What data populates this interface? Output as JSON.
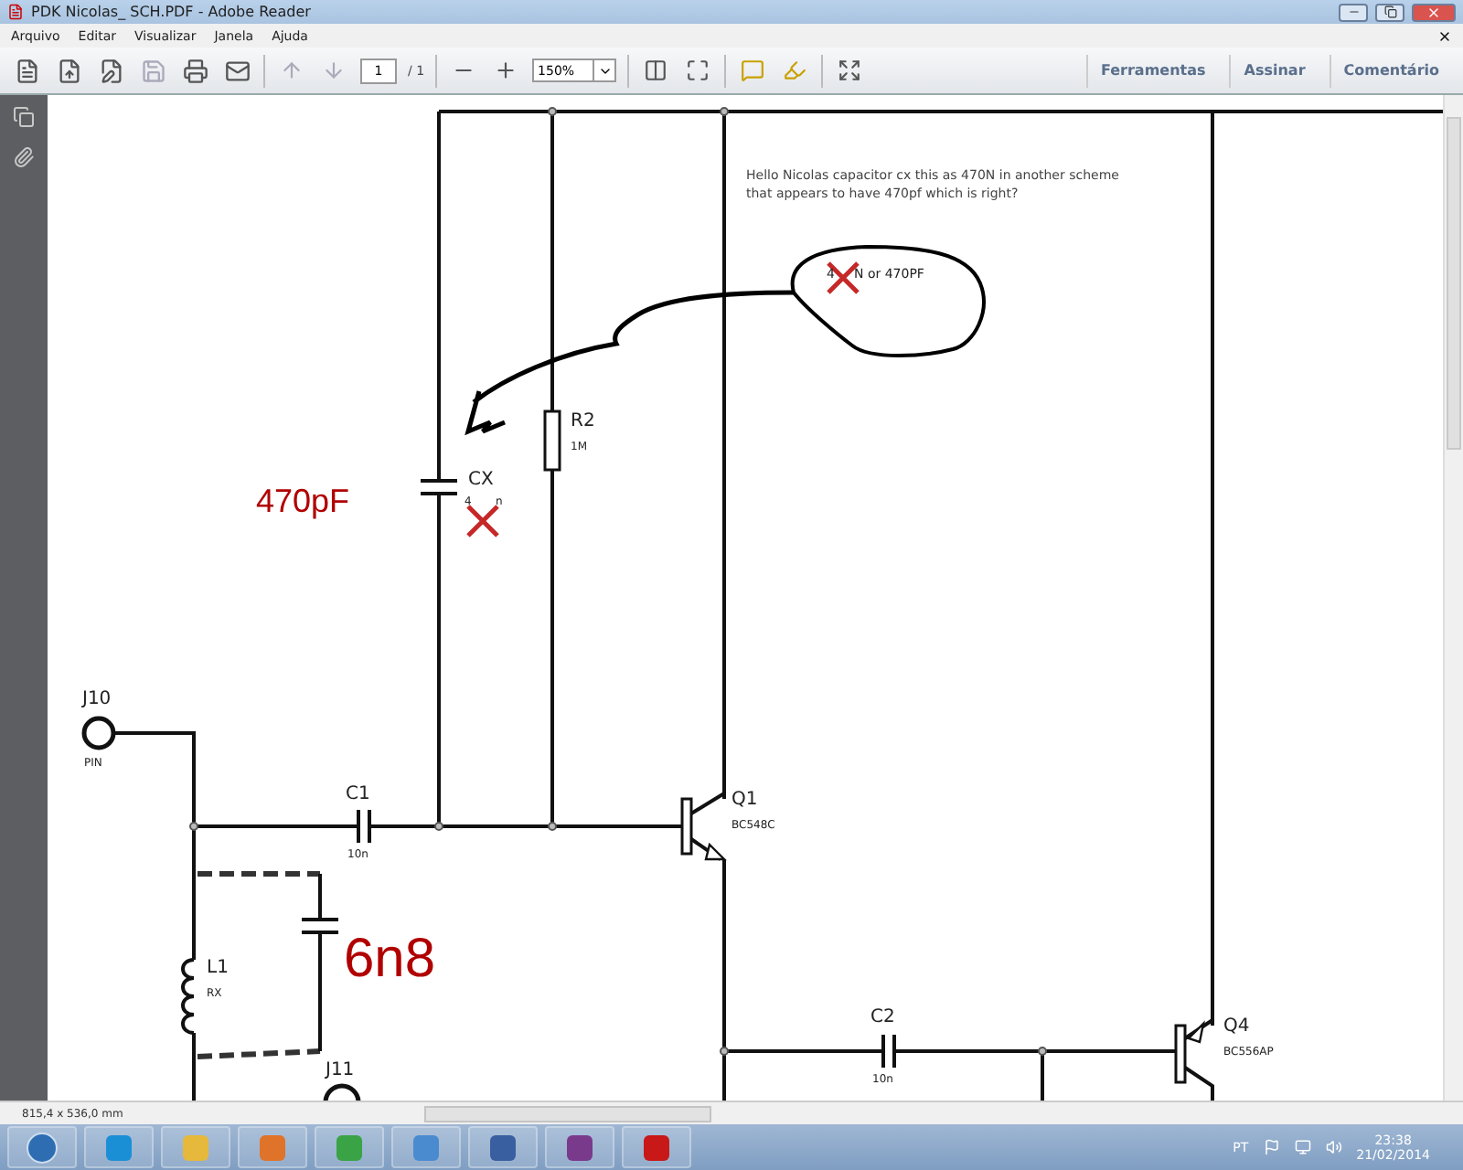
{
  "window": {
    "title": "PDK Nicolas_ SCH.PDF - Adobe Reader"
  },
  "menu": [
    "Arquivo",
    "Editar",
    "Visualizar",
    "Janela",
    "Ajuda"
  ],
  "toolbar": {
    "page": "1",
    "page_total": "/ 1",
    "zoom": "150%",
    "panels": [
      "Ferramentas",
      "Assinar",
      "Comentário"
    ]
  },
  "schematic": {
    "labels": [
      {
        "text": "Hello Nicolas capacitor cx this as 470N in another scheme that appears to have 470pf which is right?",
        "kind": "note"
      },
      {
        "text": "4",
        "kind": "note"
      },
      {
        "text": "N or 470PF",
        "kind": "note"
      },
      {
        "text": "R2",
        "kind": "ref"
      },
      {
        "text": "1M",
        "kind": "value"
      },
      {
        "text": "CX",
        "kind": "ref"
      },
      {
        "text": "470pF",
        "kind": "handwritten"
      },
      {
        "text": "4",
        "kind": "value"
      },
      {
        "text": "n",
        "kind": "value"
      },
      {
        "text": "J10",
        "kind": "ref"
      },
      {
        "text": "PIN",
        "kind": "value"
      },
      {
        "text": "C1",
        "kind": "ref"
      },
      {
        "text": "Q1",
        "kind": "ref"
      },
      {
        "text": "BC548C",
        "kind": "value"
      },
      {
        "text": "10n",
        "kind": "value"
      },
      {
        "text": "L1",
        "kind": "ref"
      },
      {
        "text": "RX",
        "kind": "value"
      },
      {
        "text": "6n8",
        "kind": "handwritten"
      },
      {
        "text": "C2",
        "kind": "ref"
      },
      {
        "text": "Q4",
        "kind": "ref"
      },
      {
        "text": "BC556AP",
        "kind": "value"
      },
      {
        "text": "10n",
        "kind": "value"
      },
      {
        "text": "J11",
        "kind": "ref"
      }
    ]
  },
  "status": {
    "size": "815,4 x 536,0 mm"
  },
  "tray": {
    "language": "PT",
    "time": "23:38",
    "date": "21/02/2014"
  }
}
